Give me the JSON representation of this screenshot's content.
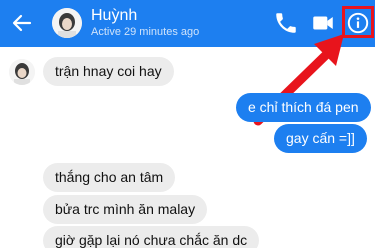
{
  "colors": {
    "header": "#1d7ff0",
    "outgoing_bubble": "#1d7ff0",
    "incoming_bubble": "#ececec",
    "highlight": "#e8141c"
  },
  "header": {
    "contact_name": "Huỳnh",
    "status": "Active 29 minutes ago",
    "icons": [
      "back-arrow-icon",
      "phone-icon",
      "video-camera-icon",
      "info-icon"
    ]
  },
  "messages": [
    {
      "side": "in",
      "text": "trận hnay coi hay"
    },
    {
      "side": "out",
      "text": "e chỉ thích đá pen"
    },
    {
      "side": "out",
      "text": "gay cấn =]]"
    },
    {
      "side": "in",
      "text": "thắng cho an tâm"
    },
    {
      "side": "in",
      "text": "bửa trc mình ăn malay"
    },
    {
      "side": "in",
      "text": "giờ gặp lại nó chưa chắc ăn dc"
    }
  ]
}
